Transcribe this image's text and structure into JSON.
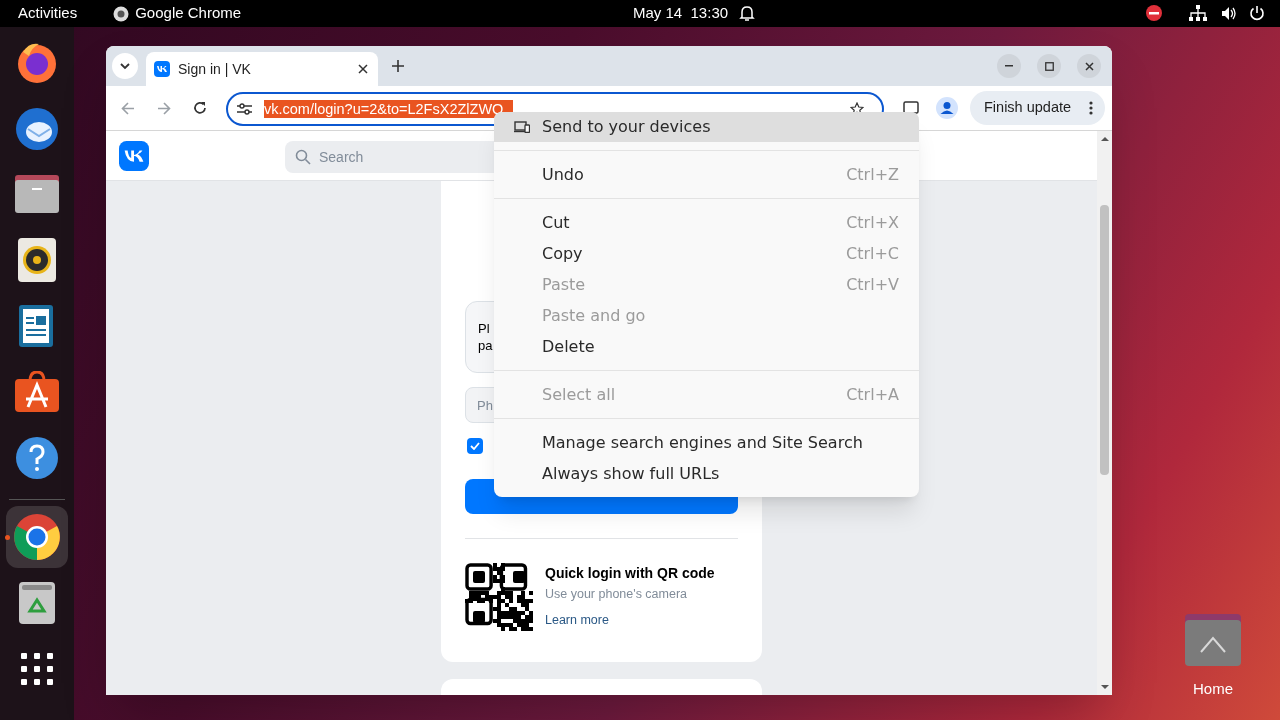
{
  "top_bar": {
    "activities": "Activities",
    "app": "Google Chrome",
    "clock": "May 14  13:30"
  },
  "dock": [
    {
      "kind": "firefox",
      "running": false
    },
    {
      "kind": "mail",
      "running": false
    },
    {
      "kind": "files",
      "running": false
    },
    {
      "kind": "music",
      "running": false
    },
    {
      "kind": "writer",
      "running": false
    },
    {
      "kind": "store",
      "running": false
    },
    {
      "kind": "help",
      "running": false
    },
    {
      "kind": "chrome",
      "running": true
    },
    {
      "kind": "trash",
      "running": false
    },
    {
      "kind": "apps",
      "running": false
    }
  ],
  "browser": {
    "tab": {
      "title": "Sign in | VK"
    },
    "address": "vk.com/login?u=2&to=L2FsX2ZlZWQ",
    "update_button": "Finish update"
  },
  "page": {
    "search_placeholder": "Search",
    "info_lines": [
      "Pl",
      "pa"
    ],
    "phone_placeholder": "Ph",
    "remember": {
      "checked": true
    },
    "qr": {
      "title": "Quick login with QR code",
      "subtitle": "Use your phone's camera",
      "link": "Learn more"
    }
  },
  "context_menu": [
    {
      "kind": "header",
      "label": "Send to your devices",
      "selected": true
    },
    {
      "kind": "separator"
    },
    {
      "kind": "item",
      "label": "Undo",
      "shortcut": "Ctrl+Z",
      "disabled": false,
      "selected": false
    },
    {
      "kind": "separator"
    },
    {
      "kind": "item",
      "label": "Cut",
      "shortcut": "Ctrl+X",
      "disabled": false,
      "selected": false
    },
    {
      "kind": "item",
      "label": "Copy",
      "shortcut": "Ctrl+C",
      "disabled": false,
      "selected": false
    },
    {
      "kind": "item",
      "label": "Paste",
      "shortcut": "Ctrl+V",
      "disabled": true,
      "selected": false
    },
    {
      "kind": "item",
      "label": "Paste and go",
      "disabled": true,
      "selected": false
    },
    {
      "kind": "item",
      "label": "Delete",
      "disabled": false,
      "selected": false
    },
    {
      "kind": "separator"
    },
    {
      "kind": "item",
      "label": "Select all",
      "shortcut": "Ctrl+A",
      "disabled": true,
      "selected": false
    },
    {
      "kind": "separator"
    },
    {
      "kind": "item",
      "label": "Manage search engines and Site Search",
      "disabled": false,
      "selected": false
    },
    {
      "kind": "item",
      "label": "Always show full URLs",
      "disabled": false,
      "selected": false
    }
  ],
  "desktop": [
    {
      "label": "Home"
    }
  ]
}
